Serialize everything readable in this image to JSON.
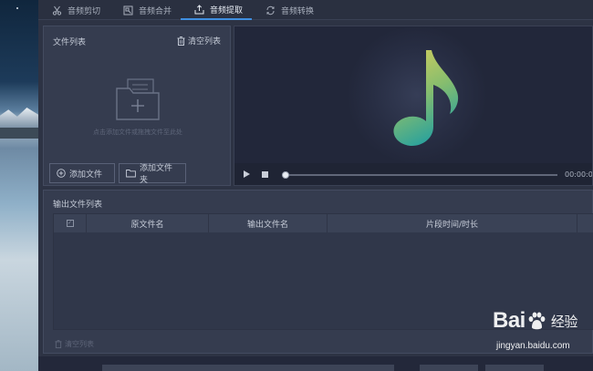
{
  "tabs": [
    {
      "label": "音频剪切",
      "icon": "scissors-icon"
    },
    {
      "label": "音频合并",
      "icon": "merge-icon"
    },
    {
      "label": "音频提取",
      "icon": "extract-icon",
      "active": true
    },
    {
      "label": "音频转换",
      "icon": "convert-icon"
    }
  ],
  "file_panel": {
    "title": "文件列表",
    "clear_label": "清空列表",
    "drop_hint": "点击添加文件或拖拽文件至此处",
    "add_file_label": "添加文件",
    "add_folder_label": "添加文件夹"
  },
  "player": {
    "time": "00:00:0",
    "icon": "music-note-icon"
  },
  "output": {
    "title": "输出文件列表",
    "columns": [
      "原文件名",
      "输出文件名",
      "片段时间/时长"
    ],
    "clear_label": "清空列表"
  },
  "watermark": {
    "brand_left": "Bai",
    "brand_right": "经验",
    "url": "jingyan.baidu.com"
  },
  "colors": {
    "accent": "#3f8fe0",
    "background": "#2d3344",
    "panel": "#353c4f",
    "note_gradient_top": "#d9cf5c",
    "note_gradient_bottom": "#2fa39a"
  }
}
